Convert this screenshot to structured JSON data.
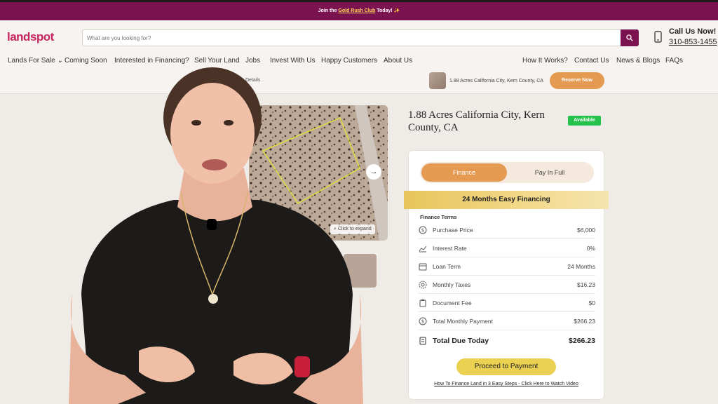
{
  "promo": {
    "prefix": "Join the",
    "link": "Gold Rush Club",
    "suffix": "Today! ✨"
  },
  "header": {
    "logo": "landspot",
    "search_placeholder": "What are you looking for?",
    "call_label": "Call Us Now!",
    "call_number": "310-853-1455"
  },
  "nav": {
    "left": [
      "Lands For Sale ⌄",
      "Coming Soon",
      "Interested in Financing?",
      "Sell Your Land",
      "Jobs",
      "Invest With Us",
      "Happy Customers",
      "About Us"
    ],
    "right": [
      "How It Works?",
      "Contact Us",
      "News & Blogs",
      "FAQs"
    ]
  },
  "subbar": {
    "crumb": "Details",
    "mini_title": "1.88 Acres California City, Kern County, CA",
    "reserve": "Reserve Now"
  },
  "gallery": {
    "expand": "Click to expand",
    "next": "→"
  },
  "property": {
    "title": "1.88 Acres California City, Kern County, CA",
    "status": "Available"
  },
  "card": {
    "tab_finance": "Finance",
    "tab_payfull": "Pay In Full",
    "banner": "24 Months Easy Financing",
    "terms_heading": "Finance Terms",
    "rows": [
      {
        "label": "Purchase Price",
        "value": "$6,000",
        "icon": "dollar-circle-icon"
      },
      {
        "label": "Interest Rate",
        "value": "0%",
        "icon": "chart-line-icon"
      },
      {
        "label": "Loan Term",
        "value": "24 Months",
        "icon": "calendar-icon"
      },
      {
        "label": "Monthly Taxes",
        "value": "$16.23",
        "icon": "badge-icon"
      },
      {
        "label": "Document Fee",
        "value": "$0",
        "icon": "clipboard-icon"
      },
      {
        "label": "Total Monthly Payment",
        "value": "$266.23",
        "icon": "dollar-circle-icon"
      }
    ],
    "total_label": "Total Due Today",
    "total_value": "$266.23",
    "proceed": "Proceed to Payment",
    "howto": "How To Finance Land in 3 Easy Steps - Click Here to Watch Video"
  },
  "colors": {
    "brand": "#7b1350",
    "logo": "#c7255f",
    "accent": "#e59a51",
    "available": "#24c24d",
    "proceed": "#ebd152"
  }
}
